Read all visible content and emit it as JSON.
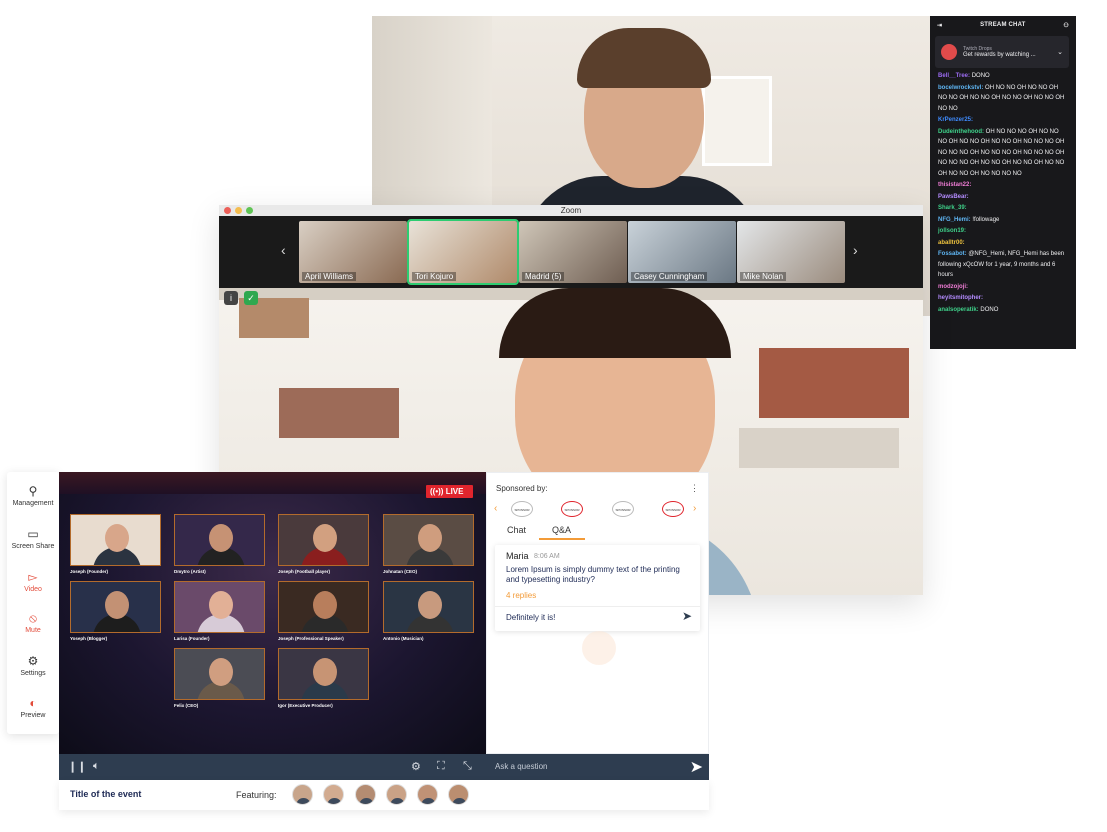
{
  "webcam": {},
  "stream_chat": {
    "header": "STREAM CHAT",
    "drops": {
      "title": "Twitch Drops",
      "subtitle": "Get rewards by watching ..."
    },
    "messages": [
      {
        "user": "Bell__Tree:",
        "color": "#9b6bf0",
        "text": "DONO"
      },
      {
        "user": "bocelwrockstvl:",
        "color": "#5fb6f4",
        "text": "OH NO NO OH NO NO OH NO NO OH NO NO OH NO NO OH NO NO OH NO NO"
      },
      {
        "user": "KrPenzer25:",
        "color": "#3f8cff",
        "text": ""
      },
      {
        "user": "Dudeinthehood:",
        "color": "#3fd18a",
        "text": "OH NO NO NO OH NO NO NO OH NO NO OH NO NO OH NO NO NO OH NO NO NO OH NO NO NO OH NO NO NO OH NO NO NO OH NO NO OH NO NO OH NO NO OH NO NO OH NO NO NO NO"
      },
      {
        "user": "thisistan22:",
        "color": "#f07dd6",
        "text": ""
      },
      {
        "user": "PawsBear:",
        "color": "#b48cff",
        "text": ""
      },
      {
        "user": "Shark_39:",
        "color": "#3fd18a",
        "text": ""
      },
      {
        "user": "NFG_Hemi:",
        "color": "#5fb6f4",
        "text": "!followage"
      },
      {
        "user": "jollson19:",
        "color": "#3fd18a",
        "text": ""
      },
      {
        "user": "aballtr00:",
        "color": "#f0c43f",
        "text": ""
      },
      {
        "user": "Fossabot:",
        "color": "#5fb6f4",
        "text": "@NFG_Hemi, NFG_Hemi has been following xQcOW for 1 year, 9 months and 6 hours"
      },
      {
        "user": "modzojoji:",
        "color": "#f07dd6",
        "text": ""
      },
      {
        "user": "heyitsmitopher:",
        "color": "#b48cff",
        "text": ""
      },
      {
        "user": "analsoperatik:",
        "color": "#3fd18a",
        "text": "DONO"
      }
    ]
  },
  "zoom": {
    "title": "Zoom",
    "participants": [
      "April Williams",
      "Tori Kojuro",
      "Madrid (5)",
      "Casey Cunningham",
      "Mike Nolan"
    ],
    "active_participant": "Tori Kojuro"
  },
  "sidebar": {
    "items": [
      {
        "label": "Management",
        "icon": "person-icon"
      },
      {
        "label": "Screen Share",
        "icon": "monitor-icon"
      },
      {
        "label": "Video",
        "icon": "video-icon"
      },
      {
        "label": "Mute",
        "icon": "mic-off-icon"
      },
      {
        "label": "Settings",
        "icon": "gear-icon"
      },
      {
        "label": "Preview",
        "icon": "toggle-icon"
      }
    ]
  },
  "stage": {
    "live_label": "LIVE",
    "speakers": [
      "Joseph (Founder)",
      "Dmytro (Artist)",
      "Joseph (Football player)",
      "Johnatan (CEO)",
      "Yoseph (Blogger)",
      "Larisa (Founder)",
      "Joseph (Professional Speaker)",
      "Antonio (Musician)",
      "Felix (CEO)",
      "Igor (Executive Producer)"
    ]
  },
  "qa_panel": {
    "sponsored_label": "Sponsored by:",
    "sponsor_logos": [
      "SPONSOR",
      "SPONSOR",
      "SPONSOR",
      "SPONSOR"
    ],
    "tabs": [
      "Chat",
      "Q&A"
    ],
    "active_tab": "Q&A",
    "question": {
      "author": "Maria",
      "time": "8:06 AM",
      "text": "Lorem Ipsum is simply dummy text of the printing and typesetting industry?",
      "replies": "4 replies",
      "answer": "Definitely it is!"
    },
    "ask_placeholder": "Ask a question"
  },
  "footer": {
    "event_title": "Title of the event",
    "featuring_label": "Featuring:",
    "featured_count": 6
  },
  "colors": {
    "accent": "#f39b38",
    "live": "#e0252d",
    "navy": "#2e3d50"
  }
}
